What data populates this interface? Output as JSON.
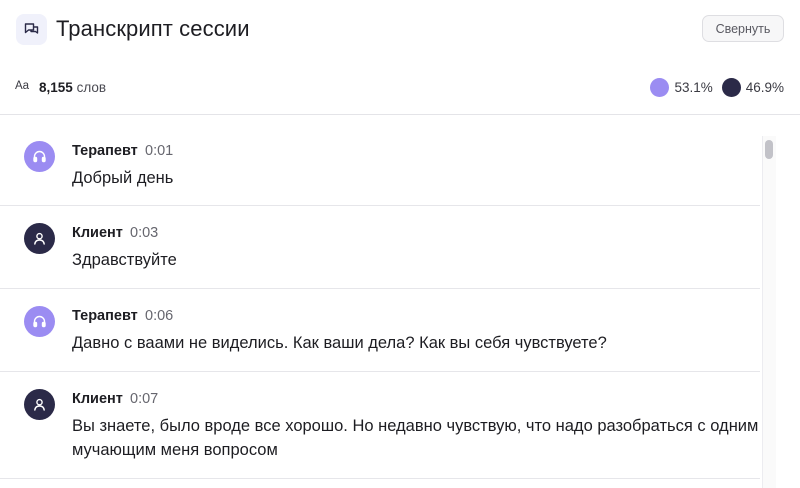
{
  "header": {
    "title": "Транскрипт сессии",
    "collapse_label": "Свернуть",
    "icon": "chat-bubbles-icon"
  },
  "stats": {
    "font_icon_label": "Aa",
    "word_count": "8,155",
    "word_unit": "слов",
    "therapist_share": "53.1%",
    "client_share": "46.9%",
    "colors": {
      "therapist": "#9b8cf2",
      "client": "#2b2a48"
    }
  },
  "messages": [
    {
      "role": "therapist",
      "speaker": "Терапевт",
      "time": "0:01",
      "text": "Добрый день",
      "icon": "headset-icon"
    },
    {
      "role": "client",
      "speaker": "Клиент",
      "time": "0:03",
      "text": "Здравствуйте",
      "icon": "user-icon"
    },
    {
      "role": "therapist",
      "speaker": "Терапевт",
      "time": "0:06",
      "text": "Давно с ваами не виделись. Как ваши дела? Как вы себя чувствуете?",
      "icon": "headset-icon"
    },
    {
      "role": "client",
      "speaker": "Клиент",
      "time": "0:07",
      "text": "Вы знаете, было вроде все хорошо. Но недавно чувствую, что надо разобраться с одним мучающим меня вопросом",
      "icon": "user-icon"
    }
  ]
}
